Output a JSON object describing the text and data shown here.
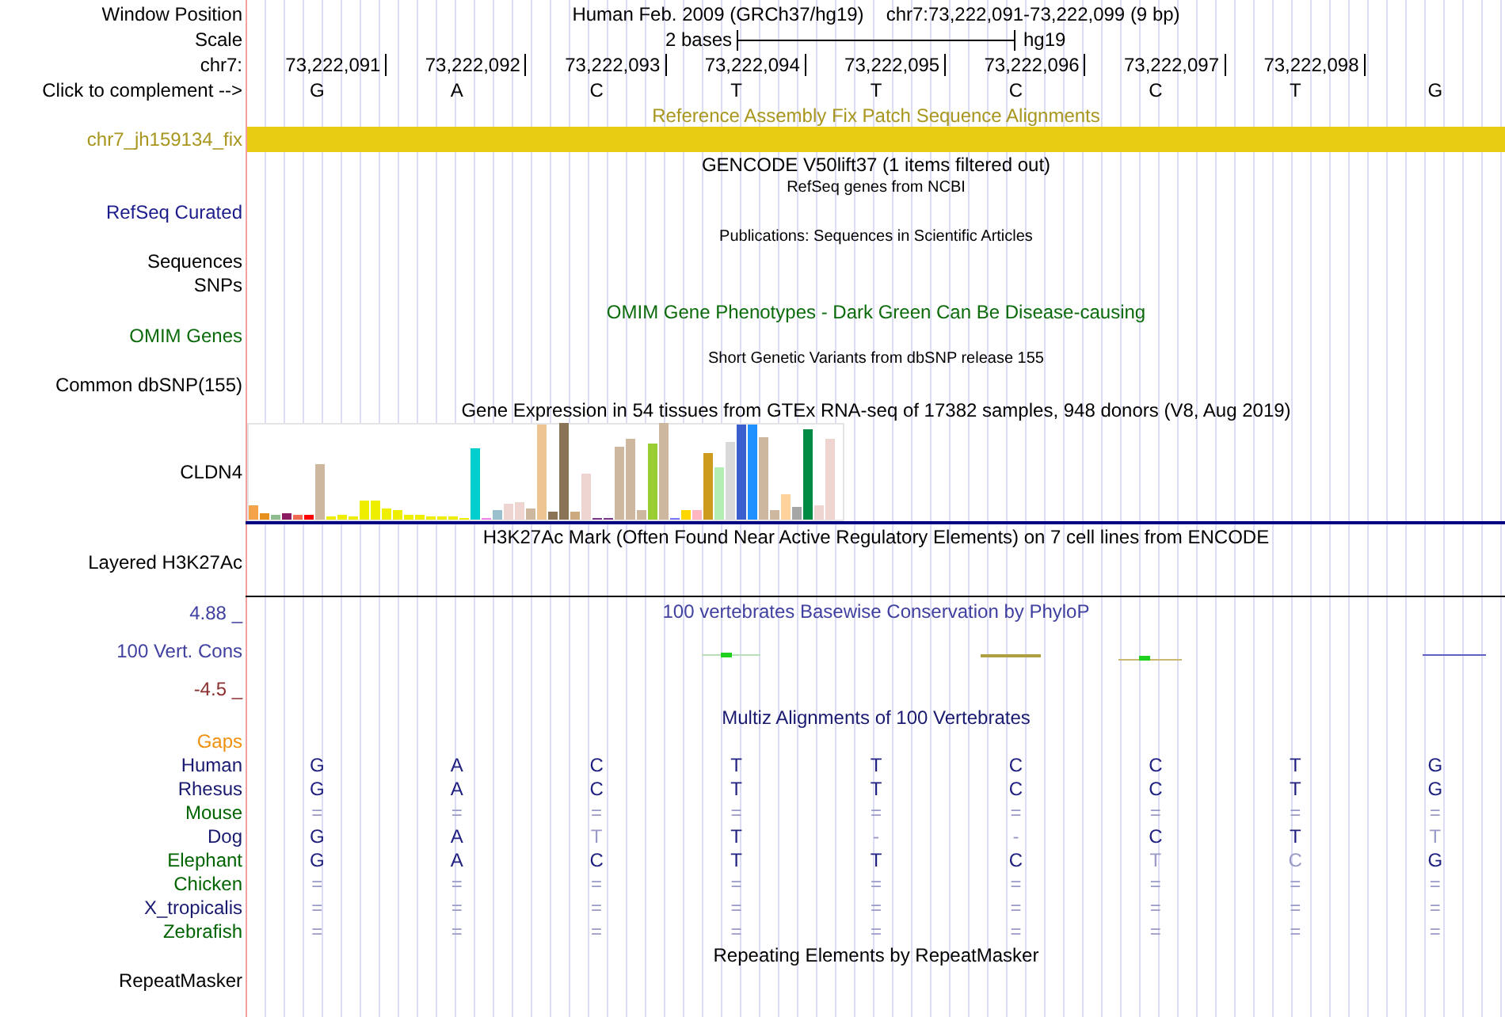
{
  "header": {
    "label": "Window Position",
    "title": "Human Feb. 2009 (GRCh37/hg19)",
    "position": "chr7:73,222,091-73,222,099 (9 bp)"
  },
  "scale": {
    "label": "Scale",
    "length": "2 bases",
    "assembly": "hg19"
  },
  "ruler": {
    "label": "chr7:",
    "positions": [
      "73,222,091",
      "73,222,092",
      "73,222,093",
      "73,222,094",
      "73,222,095",
      "73,222,096",
      "73,222,097",
      "73,222,098"
    ]
  },
  "bases": {
    "label": "Click to complement -->",
    "letters": [
      "G",
      "A",
      "C",
      "T",
      "T",
      "C",
      "C",
      "T",
      "G"
    ]
  },
  "fix_patch": {
    "title": "Reference Assembly Fix Patch Sequence Alignments",
    "label": "chr7_jh159134_fix"
  },
  "gencode": {
    "title": "GENCODE V50lift37 (1 items filtered out)"
  },
  "refseq": {
    "title": "RefSeq genes from NCBI",
    "label": "RefSeq Curated"
  },
  "publications": {
    "title": "Publications: Sequences in Scientific Articles",
    "labels": [
      "Sequences",
      "SNPs"
    ]
  },
  "omim": {
    "title": "OMIM Gene Phenotypes - Dark Green Can Be Disease-causing",
    "label": "OMIM Genes"
  },
  "dbsnp": {
    "title": "Short Genetic Variants from dbSNP release 155",
    "label": "Common dbSNP(155)"
  },
  "gtex": {
    "title": "Gene Expression in 54 tissues from GTEx RNA-seq of 17382 samples, 948 donors (V8, Aug 2019)",
    "label": "CLDN4"
  },
  "h3k27ac": {
    "title": "H3K27Ac Mark (Often Found Near Active Regulatory Elements) on 7 cell lines from ENCODE",
    "label": "Layered H3K27Ac"
  },
  "phylop": {
    "title": "100 vertebrates Basewise Conservation by PhyloP",
    "label": "100 Vert. Cons",
    "max_label": "4.88 _",
    "min_label": "-4.5 _"
  },
  "multiz": {
    "title": "Multiz Alignments of 100 Vertebrates",
    "gaps_label": "Gaps",
    "species": [
      {
        "name": "Human",
        "color": "#191970",
        "bases": [
          "G",
          "A",
          "C",
          "T",
          "T",
          "C",
          "C",
          "T",
          "G"
        ],
        "faded": [
          false,
          false,
          false,
          false,
          false,
          false,
          false,
          false,
          false
        ]
      },
      {
        "name": "Rhesus",
        "color": "#191970",
        "bases": [
          "G",
          "A",
          "C",
          "T",
          "T",
          "C",
          "C",
          "T",
          "G"
        ],
        "faded": [
          false,
          false,
          false,
          false,
          false,
          false,
          false,
          false,
          false
        ]
      },
      {
        "name": "Mouse",
        "color": "#006400",
        "bases": [
          "=",
          "=",
          "=",
          "=",
          "=",
          "=",
          "=",
          "=",
          "="
        ],
        "faded": [
          true,
          true,
          true,
          true,
          true,
          true,
          true,
          true,
          true
        ]
      },
      {
        "name": "Dog",
        "color": "#191970",
        "bases": [
          "G",
          "A",
          "T",
          "T",
          "-",
          "-",
          "C",
          "T",
          "T"
        ],
        "faded": [
          false,
          false,
          true,
          false,
          true,
          true,
          false,
          false,
          true
        ]
      },
      {
        "name": "Elephant",
        "color": "#006400",
        "bases": [
          "G",
          "A",
          "C",
          "T",
          "T",
          "C",
          "T",
          "C",
          "G"
        ],
        "faded": [
          false,
          false,
          false,
          false,
          false,
          false,
          true,
          true,
          false
        ]
      },
      {
        "name": "Chicken",
        "color": "#006400",
        "bases": [
          "=",
          "=",
          "=",
          "=",
          "=",
          "=",
          "=",
          "=",
          "="
        ],
        "faded": [
          true,
          true,
          true,
          true,
          true,
          true,
          true,
          true,
          true
        ]
      },
      {
        "name": "X_tropicalis",
        "color": "#191970",
        "bases": [
          "=",
          "=",
          "=",
          "=",
          "=",
          "=",
          "=",
          "=",
          "="
        ],
        "faded": [
          true,
          true,
          true,
          true,
          true,
          true,
          true,
          true,
          true
        ]
      },
      {
        "name": "Zebrafish",
        "color": "#006400",
        "bases": [
          "=",
          "=",
          "=",
          "=",
          "=",
          "=",
          "=",
          "=",
          "="
        ],
        "faded": [
          true,
          true,
          true,
          true,
          true,
          true,
          true,
          true,
          true
        ]
      }
    ]
  },
  "repeatmasker": {
    "title": "Repeating Elements by RepeatMasker",
    "label": "RepeatMasker"
  }
}
